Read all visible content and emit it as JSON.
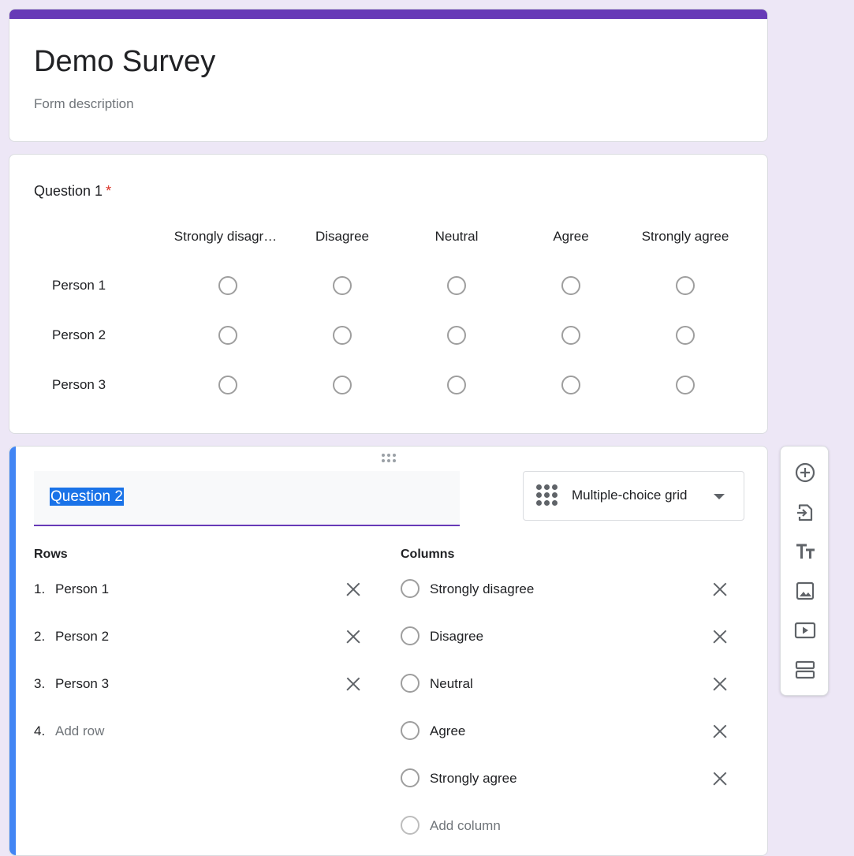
{
  "form": {
    "title": "Demo Survey",
    "description": "Form description"
  },
  "question1": {
    "title": "Question 1",
    "required_mark": "*",
    "columns": [
      "Strongly disagr…",
      "Disagree",
      "Neutral",
      "Agree",
      "Strongly agree"
    ],
    "rows": [
      "Person 1",
      "Person 2",
      "Person 3"
    ]
  },
  "question2": {
    "title": "Question 2",
    "type_label": "Multiple-choice grid",
    "rows_heading": "Rows",
    "columns_heading": "Columns",
    "rows": [
      {
        "num": "1.",
        "label": "Person 1"
      },
      {
        "num": "2.",
        "label": "Person 2"
      },
      {
        "num": "3.",
        "label": "Person 3"
      }
    ],
    "add_row": {
      "num": "4.",
      "label": "Add row"
    },
    "columns": [
      "Strongly disagree",
      "Disagree",
      "Neutral",
      "Agree",
      "Strongly agree"
    ],
    "add_column": "Add column"
  },
  "toolbar": {
    "icons": [
      "add-question-icon",
      "import-questions-icon",
      "add-title-icon",
      "add-image-icon",
      "add-video-icon",
      "add-section-icon"
    ]
  },
  "colors": {
    "theme": "#673ab7",
    "background": "#ede7f6",
    "active_bar": "#4285f4",
    "required": "#d93025",
    "selection": "#1a73e8"
  }
}
